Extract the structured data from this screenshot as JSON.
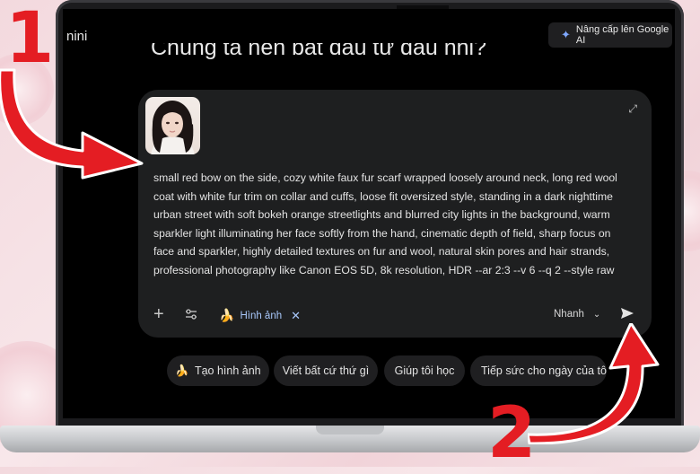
{
  "header": {
    "app_name": "nini",
    "upgrade_label": "Nâng cấp lên Google AI"
  },
  "headline": "Chúng ta nên bắt đầu từ đâu nhỉ?",
  "composer": {
    "prompt_text": "small red bow on the side, cozy white faux fur scarf wrapped loosely around neck, long red wool coat with white fur trim on collar and cuffs, loose fit oversized style, standing in a dark nighttime urban street with soft bokeh orange streetlights and blurred city lights in the background, warm sparkler light illuminating her face softly from the hand, cinematic depth of field, sharp focus on face and sparkler, highly detailed textures on fur and wool, natural skin pores and hair strands, professional photography like Canon EOS 5D, 8k resolution, HDR --ar 2:3 --v 6 --q 2 --style raw",
    "tool_chip_label": "Hình ảnh",
    "mode_label": "Nhanh"
  },
  "suggestions": [
    {
      "label": "Tạo hình ảnh",
      "icon": "banana-icon"
    },
    {
      "label": "Viết bất cứ thứ gì"
    },
    {
      "label": "Giúp tôi học"
    },
    {
      "label": "Tiếp sức cho ngày của tôi"
    }
  ],
  "annotations": {
    "step1": "1",
    "step2": "2",
    "color": "#e41d23"
  },
  "colors": {
    "accent_blue": "#a8c7fa",
    "card_bg": "#1e1f20"
  }
}
